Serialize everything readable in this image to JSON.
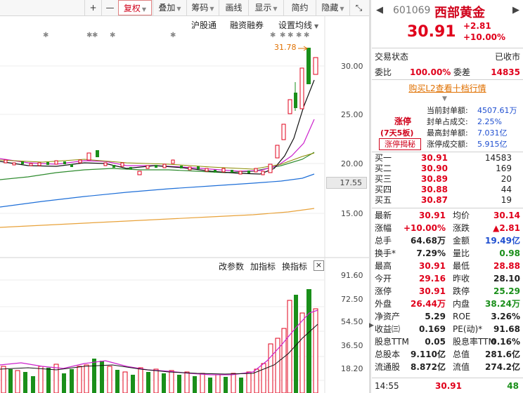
{
  "toolbar": {
    "plus": "+",
    "minus": "—",
    "fuquan": "复权",
    "diejia": "叠加",
    "choumas": "筹码",
    "huaxian": "画线",
    "xianshi": "显示",
    "jianyue": "简约",
    "yincang": "隐藏",
    "expand": "⤡"
  },
  "subbar": {
    "hugutong": "沪股通",
    "rongzi": "融资融券",
    "junxian": "设置均线"
  },
  "main_chart": {
    "peak_label": "31.78",
    "y_ticks": [
      "30.00",
      "25.00",
      "20.00",
      "15.00"
    ],
    "current_tag": "17.55"
  },
  "indicator": {
    "gaicanshu": "改参数",
    "jiazhibiao": "加指标",
    "huanzhibiao": "换指标",
    "close": "×",
    "y_ticks": [
      "91.60",
      "72.50",
      "54.50",
      "36.50",
      "18.20"
    ]
  },
  "colors": {
    "up": "#e0001b",
    "down": "#1a8f1a",
    "ma5": "#111111",
    "ma10": "#cc22cc",
    "ma20": "#2e8b2e",
    "ma60": "#1e6fd8",
    "ma120": "#e8a23a"
  },
  "quote": {
    "code": "601069",
    "name": "西部黄金",
    "price": "30.91",
    "change": "+2.81",
    "change_pct": "+10.00%",
    "status_label": "交易状态",
    "status_value": "已收市",
    "weibi_label": "委比",
    "weibi_value": "100.00%",
    "weicha_label": "委差",
    "weicha_value": "14835",
    "l2_link": "购买L2查看十档行情",
    "zhangting": "涨停",
    "days_boards": "(7天5板)",
    "reveal_btn": "涨停揭秘",
    "seal": [
      {
        "label": "当前封单额:",
        "value": "4507.61万"
      },
      {
        "label": "封单占成交:",
        "value": "2.25%"
      },
      {
        "label": "最高封单额:",
        "value": "7.031亿"
      },
      {
        "label": "涨停成交额:",
        "value": "5.915亿"
      }
    ],
    "bids": [
      {
        "label": "买一",
        "price": "30.91",
        "vol": "14583"
      },
      {
        "label": "买二",
        "price": "30.90",
        "vol": "169"
      },
      {
        "label": "买三",
        "price": "30.89",
        "vol": "20"
      },
      {
        "label": "买四",
        "price": "30.88",
        "vol": "44"
      },
      {
        "label": "买五",
        "price": "30.87",
        "vol": "19"
      }
    ],
    "stats": [
      {
        "l1": "最新",
        "v1": "30.91",
        "c1": "red",
        "l2": "均价",
        "v2": "30.14",
        "c2": "red"
      },
      {
        "l1": "涨幅",
        "v1": "+10.00%",
        "c1": "red",
        "l2": "涨跌",
        "v2": "▲2.81",
        "c2": "red"
      },
      {
        "l1": "总手",
        "v1": "64.68万",
        "c1": "",
        "l2": "金额",
        "v2": "19.49亿",
        "c2": "blue"
      },
      {
        "l1": "换手*",
        "v1": "7.29%",
        "c1": "",
        "l2": "量比",
        "v2": "0.98",
        "c2": "green"
      },
      {
        "l1": "最高",
        "v1": "30.91",
        "c1": "red",
        "l2": "最低",
        "v2": "28.88",
        "c2": "red"
      },
      {
        "l1": "今开",
        "v1": "29.16",
        "c1": "red",
        "l2": "昨收",
        "v2": "28.10",
        "c2": ""
      },
      {
        "l1": "涨停",
        "v1": "30.91",
        "c1": "red",
        "l2": "跌停",
        "v2": "25.29",
        "c2": "green"
      },
      {
        "l1": "外盘",
        "v1": "26.44万",
        "c1": "red",
        "l2": "内盘",
        "v2": "38.24万",
        "c2": "green"
      },
      {
        "l1": "净资产",
        "v1": "5.29",
        "c1": "",
        "l2": "ROE",
        "v2": "3.26%",
        "c2": ""
      },
      {
        "l1": "收益㈢",
        "v1": "0.169",
        "c1": "",
        "l2": "PE(动)*",
        "v2": "91.68",
        "c2": ""
      },
      {
        "l1": "股息TTM",
        "v1": "0.05",
        "c1": "",
        "l2": "股息率TTM",
        "v2": "0.16%",
        "c2": ""
      },
      {
        "l1": "总股本",
        "v1": "9.110亿",
        "c1": "",
        "l2": "总值",
        "v2": "281.6亿",
        "c2": ""
      },
      {
        "l1": "流通股",
        "v1": "8.872亿",
        "c1": "",
        "l2": "流值",
        "v2": "274.2亿",
        "c2": ""
      }
    ],
    "tick_time": "14:55",
    "tick_price": "30.91",
    "tick_vol": "48"
  }
}
